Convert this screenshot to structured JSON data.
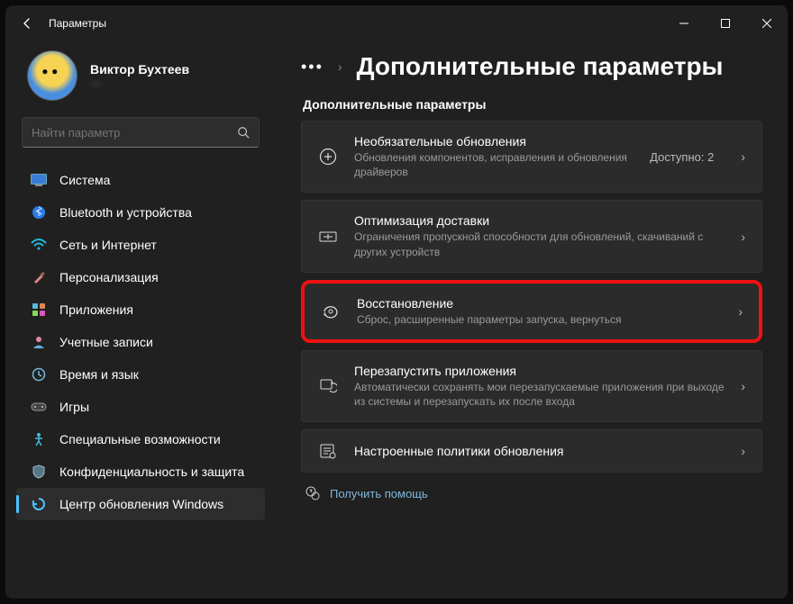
{
  "window": {
    "title": "Параметры"
  },
  "profile": {
    "name": "Виктор Бухтеев",
    "email": "—"
  },
  "search": {
    "placeholder": "Найти параметр"
  },
  "nav": [
    {
      "id": "system",
      "label": "Система"
    },
    {
      "id": "bluetooth",
      "label": "Bluetooth и устройства"
    },
    {
      "id": "network",
      "label": "Сеть и Интернет"
    },
    {
      "id": "personalization",
      "label": "Персонализация"
    },
    {
      "id": "apps",
      "label": "Приложения"
    },
    {
      "id": "accounts",
      "label": "Учетные записи"
    },
    {
      "id": "time",
      "label": "Время и язык"
    },
    {
      "id": "gaming",
      "label": "Игры"
    },
    {
      "id": "accessibility",
      "label": "Специальные возможности"
    },
    {
      "id": "privacy",
      "label": "Конфиденциальность и защита"
    },
    {
      "id": "update",
      "label": "Центр обновления Windows"
    }
  ],
  "page": {
    "heading": "Дополнительные параметры",
    "section": "Дополнительные параметры"
  },
  "cards": {
    "optional": {
      "title": "Необязательные обновления",
      "sub": "Обновления компонентов, исправления и обновления драйверов",
      "trail": "Доступно: 2"
    },
    "delivery": {
      "title": "Оптимизация доставки",
      "sub": "Ограничения пропускной способности для обновлений, скачиваний с других устройств"
    },
    "recovery": {
      "title": "Восстановление",
      "sub": "Сброс, расширенные параметры запуска, вернуться"
    },
    "restart": {
      "title": "Перезапустить приложения",
      "sub": "Автоматически сохранять мои перезапускаемые приложения при выходе из системы и перезапускать их после входа"
    },
    "policies": {
      "title": "Настроенные политики обновления"
    }
  },
  "help": {
    "label": "Получить помощь"
  }
}
